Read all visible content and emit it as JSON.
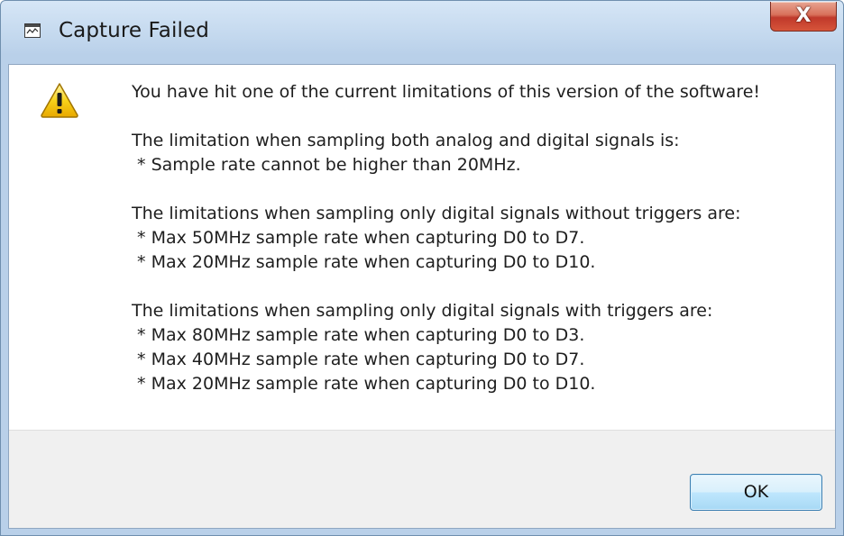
{
  "window": {
    "title": "Capture Failed",
    "close_label": "X",
    "icon": "application-window-icon"
  },
  "dialog": {
    "icon": "warning-icon",
    "icon_color": "#f5c400",
    "lines": [
      "You have hit one of the current limitations of this version of the software!",
      "",
      "The limitation when sampling both analog and digital signals is:",
      " * Sample rate cannot be higher than 20MHz.",
      "",
      "The limitations when sampling only digital signals without triggers are:",
      " * Max 50MHz sample rate when capturing D0 to D7.",
      " * Max 20MHz sample rate when capturing D0 to D10.",
      "",
      "The limitations when sampling only digital signals with triggers are:",
      " * Max 80MHz sample rate when capturing D0 to D3.",
      " * Max 40MHz sample rate when capturing D0 to D7.",
      " * Max 20MHz sample rate when capturing D0 to D10."
    ]
  },
  "buttons": {
    "ok_label": "OK"
  },
  "colors": {
    "titlebar": "#c3d8ee",
    "close_button": "#c0392b",
    "footer": "#f0f0f0",
    "ok_border": "#3c7fb1"
  }
}
